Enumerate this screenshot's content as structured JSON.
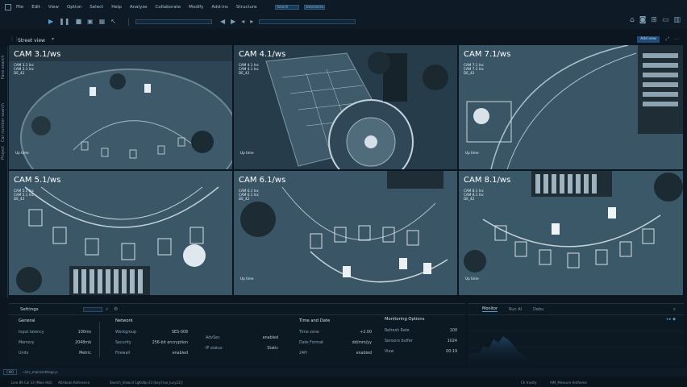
{
  "menu": {
    "items": [
      "File",
      "Edit",
      "View",
      "Option",
      "Select",
      "Help",
      "Analyze",
      "Collaborate",
      "Modify",
      "Add-ins",
      "Structure"
    ],
    "fields": [
      "Search",
      "Extensions"
    ]
  },
  "view": {
    "title": "Street view",
    "add_label": "Add new"
  },
  "side_tabs": [
    "Face search",
    "Car number search",
    "Project"
  ],
  "cameras": [
    {
      "label": "CAM 3.1/ws",
      "info": [
        "CAM 3.1 Inc",
        "CAM 3.1 Inc",
        "DE_42"
      ],
      "uptime": "Up time"
    },
    {
      "label": "CAM 4.1/ws",
      "info": [
        "CAM 4.1 Inc",
        "CAM 4.1 Inc",
        "DE_42"
      ],
      "uptime": "Up time"
    },
    {
      "label": "CAM 7.1/ws",
      "info": [
        "CAM 7.1 Inc",
        "CAM 7.1 Inc",
        "DE_42"
      ],
      "uptime": "Up time"
    },
    {
      "label": "CAM 5.1/ws",
      "info": [
        "CAM 5.1 Inc",
        "CAM 5.1 Inc",
        "DE_42"
      ],
      "uptime": ""
    },
    {
      "label": "CAM 6.1/ws",
      "info": [
        "CAM 6.1 Inc",
        "CAM 6.1 Inc",
        "DE_42"
      ],
      "uptime": "Up time"
    },
    {
      "label": "CAM 8.1/ws",
      "info": [
        "CAM 8.1 Inc",
        "CAM 8.1 Inc",
        "DE_42"
      ],
      "uptime": "Up time"
    }
  ],
  "settings": {
    "title": "Settings",
    "general": {
      "heading": "General",
      "rows": [
        {
          "label": "Input latency",
          "value": "100ms"
        },
        {
          "label": "Memory",
          "value": "2048mb"
        },
        {
          "label": "Units",
          "value": "Metric"
        }
      ]
    },
    "network": {
      "heading": "Network",
      "rows": [
        {
          "label": "Workgroup",
          "value": "SES-008"
        },
        {
          "label": "Security",
          "value": "256-bit encryption"
        },
        {
          "label": "Firewall",
          "value": "enabled"
        }
      ],
      "extra": [
        {
          "label": "AdvSec",
          "value": "enabled"
        },
        {
          "label": "IP status",
          "value": "Static"
        }
      ]
    },
    "time": {
      "heading": "Time and Date",
      "rows": [
        {
          "label": "Time zone",
          "value": "+2.00"
        },
        {
          "label": "Date Format",
          "value": "dd/mm/yy"
        },
        {
          "label": "24H",
          "value": "enabled"
        }
      ]
    },
    "monitoring": {
      "heading": "Monitoring Options",
      "rows": [
        {
          "label": "Refresh Rate",
          "value": "100"
        },
        {
          "label": "Sensors buffer",
          "value": "1024"
        },
        {
          "label": "View",
          "value": "00:19"
        }
      ]
    }
  },
  "monitor": {
    "tabs": [
      "Monitor",
      "Run AI",
      "Debu"
    ]
  },
  "status": {
    "cmd_prompt": "CMD",
    "path": "~/src_main/settings.js",
    "left": "Line 89 Col 13 (Main Hst)",
    "mid": "Attribute Reference",
    "search": "Search_View:id 1gKsNp-23 (key:[run_lucy22])",
    "right1": "Ch trustly",
    "right2": "AIM_Measure Antheme"
  },
  "colors": {
    "accent": "#4aa0e8",
    "felt": "#3d5868",
    "panel": "#0c1822"
  }
}
